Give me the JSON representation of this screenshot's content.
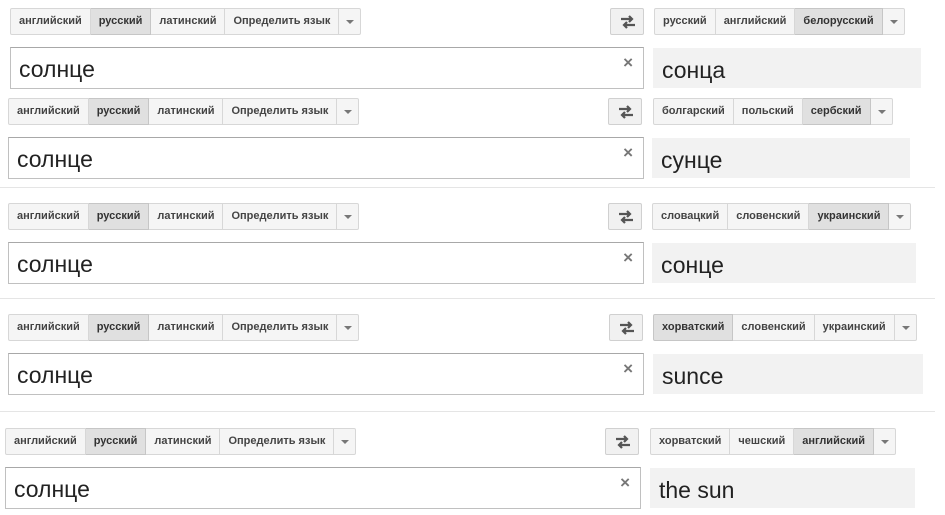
{
  "panels": [
    {
      "source_langs": [
        "английский",
        "русский",
        "латинский",
        "Определить язык"
      ],
      "source_selected": 1,
      "target_langs": [
        "русский",
        "английский",
        "белорусский"
      ],
      "target_selected": 2,
      "input_text": "солнце",
      "output_text": "сонца"
    },
    {
      "source_langs": [
        "английский",
        "русский",
        "латинский",
        "Определить язык"
      ],
      "source_selected": 1,
      "target_langs": [
        "болгарский",
        "польский",
        "сербский"
      ],
      "target_selected": 2,
      "input_text": "солнце",
      "output_text": "сунце"
    },
    {
      "source_langs": [
        "английский",
        "русский",
        "латинский",
        "Определить язык"
      ],
      "source_selected": 1,
      "target_langs": [
        "словацкий",
        "словенский",
        "украинский"
      ],
      "target_selected": 2,
      "input_text": "солнце",
      "output_text": "сонце"
    },
    {
      "source_langs": [
        "английский",
        "русский",
        "латинский",
        "Определить язык"
      ],
      "source_selected": 1,
      "target_langs": [
        "хорватский",
        "словенский",
        "украинский"
      ],
      "target_selected": 0,
      "input_text": "солнце",
      "output_text": "sunce"
    },
    {
      "source_langs": [
        "английский",
        "русский",
        "латинский",
        "Определить язык"
      ],
      "source_selected": 1,
      "target_langs": [
        "хорватский",
        "чешский",
        "английский"
      ],
      "target_selected": 2,
      "input_text": "солнце",
      "output_text": "the sun"
    }
  ],
  "icons": {
    "swap": "swap-languages-icon",
    "clear": "clear-text-icon",
    "dropdown": "chevron-down-icon"
  },
  "clear_glyph": "×",
  "colors": {
    "selected_button": "#e0e0e0",
    "button": "#f5f5f5",
    "output_bg": "#f2f2f2"
  }
}
